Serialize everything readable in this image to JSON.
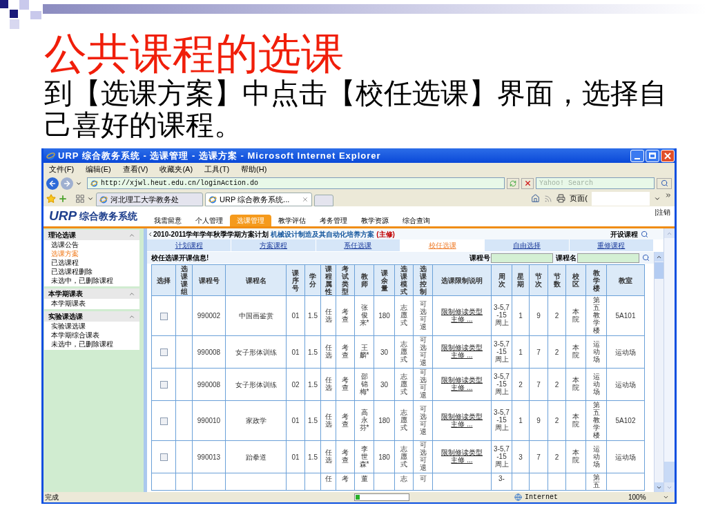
{
  "slide": {
    "title": "公共课程的选课",
    "body": "到【选课方案】中点击【校任选课】界面，选择自己喜好的课程。"
  },
  "browser": {
    "title": "URP 综合教务系统 - 选课管理 - 选课方案 - Microsoft Internet Explorer",
    "menu": [
      "文件(F)",
      "编辑(E)",
      "查看(V)",
      "收藏夹(A)",
      "工具(T)",
      "帮助(H)"
    ],
    "address": "http://xjwl.heut.edu.cn/loginAction.do",
    "search_placeholder": "Yahoo! Search",
    "tabs": [
      {
        "label": "河北理工大学教务处",
        "selected": false
      },
      {
        "label": "URP 综合教务系统...",
        "selected": true
      }
    ],
    "page_menu": "页面(",
    "status": "完成",
    "progress": {
      "level": 0.08
    },
    "zone": "Internet",
    "zoom": "100%"
  },
  "site": {
    "logo": "URP",
    "logo_text": "综合教务系统",
    "logout": "|注销",
    "nav": [
      {
        "label": "我需留意",
        "selected": false
      },
      {
        "label": "个人管理",
        "selected": false
      },
      {
        "label": "选课管理",
        "selected": true
      },
      {
        "label": "教学评估",
        "selected": false
      },
      {
        "label": "考务管理",
        "selected": false
      },
      {
        "label": "教学资源",
        "selected": false
      },
      {
        "label": "综合查询",
        "selected": false
      }
    ],
    "sidebar": [
      {
        "title": "理论选课",
        "items": [
          {
            "label": "选课公告",
            "selected": false
          },
          {
            "label": "选课方案",
            "selected": true
          },
          {
            "label": "已选课程",
            "selected": false
          },
          {
            "label": "已选课程删除",
            "selected": false
          },
          {
            "label": "未选中，已删除课程",
            "selected": false
          }
        ]
      },
      {
        "title": "本学期课表",
        "items": [
          {
            "label": "本学期课表",
            "selected": false
          }
        ]
      },
      {
        "title": "实验课选课",
        "items": [
          {
            "label": "实验课选课",
            "selected": false
          },
          {
            "label": "本学期综合课表",
            "selected": false
          },
          {
            "label": "未选中，已删除课程",
            "selected": false
          }
        ]
      }
    ],
    "plan": {
      "term": "2010-2011学年学年秋季学期方案计划",
      "program": "机械设计制造及其自动化培养方案",
      "major": "(主修)",
      "open_courses": "开设课程"
    },
    "subtabs": [
      {
        "label": "计划课程",
        "selected": false
      },
      {
        "label": "方案课程",
        "selected": false
      },
      {
        "label": "系任选课",
        "selected": false
      },
      {
        "label": "校任选课",
        "selected": true
      },
      {
        "label": "自由选择",
        "selected": false
      },
      {
        "label": "重修课程",
        "selected": false
      }
    ],
    "section_title": "校任选课开课信息!",
    "course_no_label": "课程号",
    "course_name_label": "课程名",
    "table": {
      "columns": [
        "选择",
        "选课课组",
        "课程号",
        "课程名",
        "课序号",
        "学分",
        "课程属性",
        "考试类型",
        "教师",
        "课余量",
        "选课模式",
        "选课控制",
        "选课限制说明",
        "周次",
        "星期",
        "节次",
        "节数",
        "校区",
        "教学楼",
        "教室"
      ],
      "rows": [
        {
          "checked": false,
          "course_no": "990002",
          "name": "中国画鉴赏",
          "seq": "01",
          "credit": "1.5",
          "attr": "任选",
          "exam": "考查",
          "teacher": "张俊来*",
          "remaining": "180",
          "mode": "志愿式",
          "control": "可选可退",
          "restriction": "限制修读类型主修 ...",
          "weeks": "3-5,7-15周上",
          "day": "1",
          "period": "9",
          "count": "2",
          "campus": "本院",
          "building": "第五教学楼",
          "room": "5A101"
        },
        {
          "checked": false,
          "course_no": "990008",
          "name": "女子形体训练",
          "seq": "01",
          "credit": "1.5",
          "attr": "任选",
          "exam": "考查",
          "teacher": "王麟*",
          "remaining": "30",
          "mode": "志愿式",
          "control": "可选可退",
          "restriction": "限制修读类型主修 ...",
          "weeks": "3-5,7-15周上",
          "day": "1",
          "period": "7",
          "count": "2",
          "campus": "本院",
          "building": "运动场",
          "room": "运动场"
        },
        {
          "checked": false,
          "course_no": "990008",
          "name": "女子形体训练",
          "seq": "02",
          "credit": "1.5",
          "attr": "任选",
          "exam": "考查",
          "teacher": "邵锦梅*",
          "remaining": "30",
          "mode": "志愿式",
          "control": "可选可退",
          "restriction": "限制修读类型主修 ...",
          "weeks": "3-5,7-15周上",
          "day": "2",
          "period": "7",
          "count": "2",
          "campus": "本院",
          "building": "运动场",
          "room": "运动场"
        },
        {
          "checked": false,
          "course_no": "990010",
          "name": "家政学",
          "seq": "01",
          "credit": "1.5",
          "attr": "任选",
          "exam": "考查",
          "teacher": "高永芬*",
          "remaining": "180",
          "mode": "志愿式",
          "control": "可选可退",
          "restriction": "限制修读类型主修 ...",
          "weeks": "3-5,7-15周上",
          "day": "1",
          "period": "9",
          "count": "2",
          "campus": "本院",
          "building": "第五教学楼",
          "room": "5A102"
        },
        {
          "checked": false,
          "course_no": "990013",
          "name": "跆拳道",
          "seq": "01",
          "credit": "1.5",
          "attr": "任选",
          "exam": "考查",
          "teacher": "李世森*",
          "remaining": "180",
          "mode": "志愿式",
          "control": "可选可退",
          "restriction": "限制修读类型主修 ...",
          "weeks": "3-5,7-15周上",
          "day": "3",
          "period": "7",
          "count": "2",
          "campus": "本院",
          "building": "运动场",
          "room": "运动场"
        }
      ],
      "partial_row": {
        "attr": "任",
        "exam": "考",
        "teacher": "董",
        "mode": "志",
        "control": "可",
        "weeks": "3-",
        "building": "第五"
      }
    }
  }
}
